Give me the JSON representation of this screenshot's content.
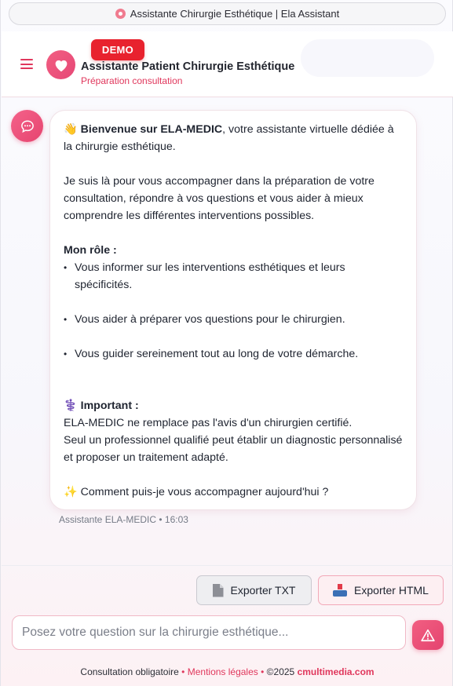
{
  "browser": {
    "url_title": "Assistante Chirurgie Esthétique | Ela Assistant",
    "url_icon": "location-pin-icon"
  },
  "header": {
    "menu_icon": "hamburger-menu-icon",
    "logo_icon": "heart-icon",
    "badge": "DEMO",
    "title": "Assistante Patient Chirurgie Esthétique",
    "subtitle": "Préparation consultation"
  },
  "colors": {
    "accent": "#e64776",
    "badge": "#e8222e",
    "text": "#1f2430"
  },
  "message": {
    "avatar_icon": "chat-bubble-icon",
    "intro_emoji": "👋",
    "intro_bold": "Bienvenue sur ELA-MEDIC",
    "intro_rest": ", votre assistante virtuelle dédiée à la chirurgie esthétique.",
    "paragraph2": "Je suis là pour vous accompagner dans la préparation de votre consultation, répondre à vos questions et vous aider à mieux comprendre les différentes interventions possibles.",
    "role_heading": "Mon rôle :",
    "role_items": [
      "Vous informer sur les interventions esthétiques et leurs spécificités.",
      "Vous aider à préparer vos questions pour le chirurgien.",
      "Vous guider sereinement tout au long de votre démarche."
    ],
    "important_emoji": "⚕️",
    "important_heading": "Important :",
    "important_lines": [
      "ELA-MEDIC ne remplace pas l'avis d'un chirurgien certifié.",
      "Seul un professionnel qualifié peut établir un diagnostic personnalisé et proposer un traitement adapté."
    ],
    "closing_emoji": "✨",
    "closing": "Comment puis-je vous accompagner aujourd'hui ?",
    "meta": "Assistante ELA-MEDIC • 16:03"
  },
  "export": {
    "txt_label": "Exporter TXT",
    "txt_icon": "document-icon",
    "html_label": "Exporter HTML",
    "html_icon": "inbox-tray-icon"
  },
  "input": {
    "placeholder": "Posez votre question sur la chirurgie esthétique...",
    "value": "",
    "send_icon": "send-warning-icon"
  },
  "footer": {
    "consult": "Consultation obligatoire",
    "separator": "•",
    "legal": "Mentions légales",
    "copyright": "©2025",
    "brand": "cmultimedia.com"
  }
}
